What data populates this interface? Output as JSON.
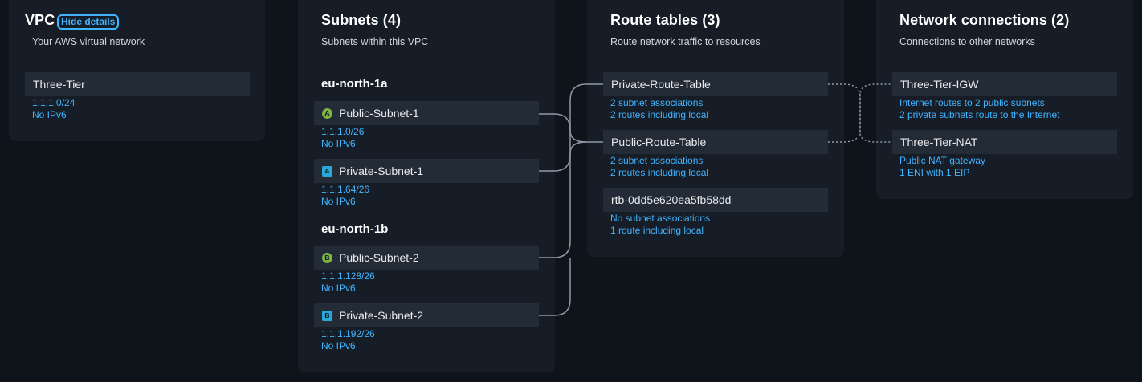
{
  "vpc": {
    "title": "VPC",
    "hide_details": "Hide details",
    "subtitle": "Your AWS virtual network",
    "name": "Three-Tier",
    "cidr": "1.1.1.0/24",
    "ipv6": "No IPv6"
  },
  "subnets": {
    "title": "Subnets (4)",
    "subtitle": "Subnets within this VPC",
    "zones": [
      {
        "name": "eu-north-1a",
        "items": [
          {
            "badge": "A",
            "name": "Public-Subnet-1",
            "cidr": "1.1.1.0/26",
            "ipv6": "No IPv6"
          },
          {
            "badge": "A",
            "name": "Private-Subnet-1",
            "cidr": "1.1.1.64/26",
            "ipv6": "No IPv6"
          }
        ]
      },
      {
        "name": "eu-north-1b",
        "items": [
          {
            "badge": "B",
            "name": "Public-Subnet-2",
            "cidr": "1.1.1.128/26",
            "ipv6": "No IPv6"
          },
          {
            "badge": "B",
            "name": "Private-Subnet-2",
            "cidr": "1.1.1.192/26",
            "ipv6": "No IPv6"
          }
        ]
      }
    ]
  },
  "route_tables": {
    "title": "Route tables (3)",
    "subtitle": "Route network traffic to resources",
    "items": [
      {
        "name": "Private-Route-Table",
        "line1": "2 subnet associations",
        "line2": "2 routes including local"
      },
      {
        "name": "Public-Route-Table",
        "line1": "2 subnet associations",
        "line2": "2 routes including local"
      },
      {
        "name": "rtb-0dd5e620ea5fb58dd",
        "line1": "No subnet associations",
        "line2": "1 route including local"
      }
    ]
  },
  "network_connections": {
    "title": "Network connections (2)",
    "subtitle": "Connections to other networks",
    "items": [
      {
        "name": "Three-Tier-IGW",
        "line1": "Internet routes to 2 public subnets",
        "line2": "2 private subnets route to the Internet"
      },
      {
        "name": "Three-Tier-NAT",
        "line1": "Public NAT gateway",
        "line2": "1 ENI with 1 EIP"
      }
    ]
  },
  "colors": {
    "background": "#0f141a",
    "panel": "#161d26",
    "item": "#232b37",
    "link": "#42b4ff",
    "public_badge": "#7cb342",
    "private_badge": "#29a9d9",
    "connector": "#8d99a8"
  }
}
